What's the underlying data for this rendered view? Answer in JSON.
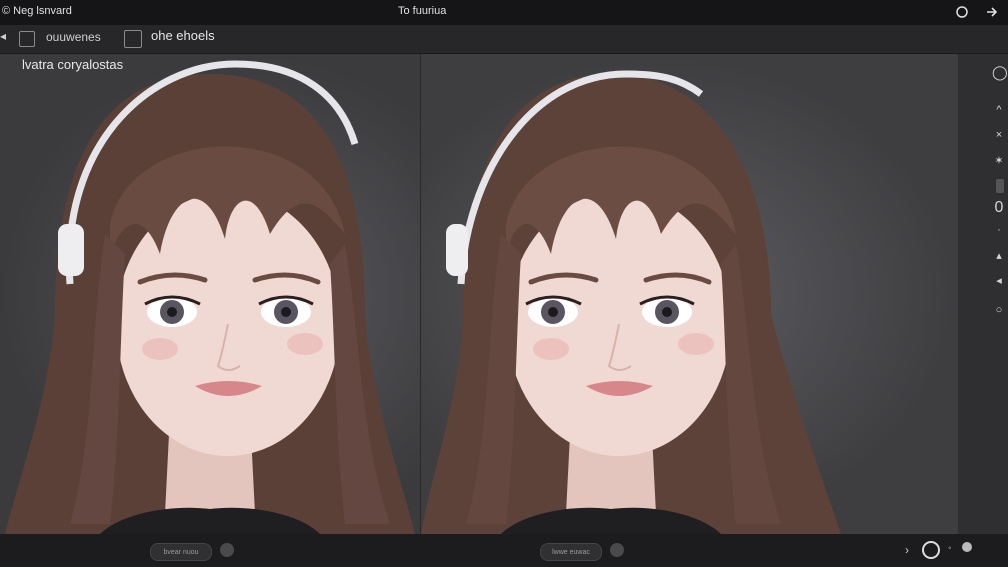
{
  "titlebar": {
    "left_title": "© Neg lsnvard",
    "center_title": "To fuuriua",
    "close_icon": "close-icon",
    "forward_icon": "arrow-right-icon"
  },
  "toolbar": {
    "item1": "ouuwenes",
    "item2": "ohe ehoels"
  },
  "canvas": {
    "label": "lvatra coryalostas"
  },
  "bottombar": {
    "left_pill": "bvear nuou",
    "right_pill": "lwwe euwac"
  },
  "sidebar": {
    "value": "0"
  },
  "colors": {
    "hair": "#5b4038",
    "skin": "#f0d9d3",
    "headphone": "#e6e6ea",
    "background": "#3a3a3d"
  }
}
